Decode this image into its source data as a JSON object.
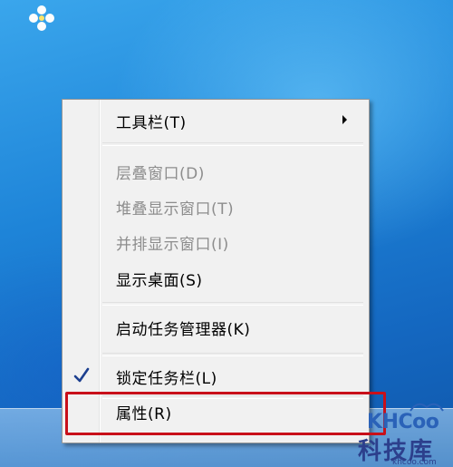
{
  "context_menu": {
    "items": [
      {
        "label": "工具栏(T)",
        "enabled": true,
        "has_submenu": true,
        "checked": false
      },
      {
        "label": "层叠窗口(D)",
        "enabled": false,
        "has_submenu": false,
        "checked": false
      },
      {
        "label": "堆叠显示窗口(T)",
        "enabled": false,
        "has_submenu": false,
        "checked": false
      },
      {
        "label": "并排显示窗口(I)",
        "enabled": false,
        "has_submenu": false,
        "checked": false
      },
      {
        "label": "显示桌面(S)",
        "enabled": true,
        "has_submenu": false,
        "checked": false
      },
      {
        "label": "启动任务管理器(K)",
        "enabled": true,
        "has_submenu": false,
        "checked": false
      },
      {
        "label": "锁定任务栏(L)",
        "enabled": true,
        "has_submenu": false,
        "checked": true
      },
      {
        "label": "属性(R)",
        "enabled": true,
        "has_submenu": false,
        "checked": false,
        "highlighted": true
      }
    ]
  },
  "watermark": {
    "brand": "KHCoo",
    "name": "科技库",
    "url": "khcoo.com"
  },
  "colors": {
    "highlight_border": "#c8101a",
    "desktop": "#1e84d8"
  },
  "icons": {
    "desktop": "flower-icon",
    "submenu": "submenu-arrow-icon",
    "check": "check-icon"
  }
}
